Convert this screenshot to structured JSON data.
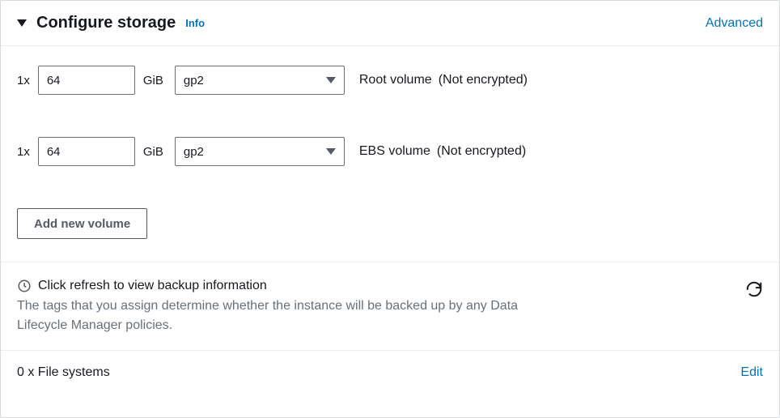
{
  "header": {
    "title": "Configure storage",
    "info_label": "Info",
    "advanced_label": "Advanced"
  },
  "volumes": [
    {
      "count_prefix": "1x",
      "size": "64",
      "unit": "GiB",
      "type": "gp2",
      "label": "Root volume",
      "encryption": "(Not encrypted)"
    },
    {
      "count_prefix": "1x",
      "size": "64",
      "unit": "GiB",
      "type": "gp2",
      "label": "EBS volume",
      "encryption": "(Not encrypted)"
    }
  ],
  "add_volume_label": "Add new volume",
  "backup": {
    "title": "Click refresh to view backup information",
    "description": "The tags that you assign determine whether the instance will be backed up by any Data Lifecycle Manager policies."
  },
  "filesystem": {
    "label": "0 x File systems",
    "edit_label": "Edit"
  }
}
